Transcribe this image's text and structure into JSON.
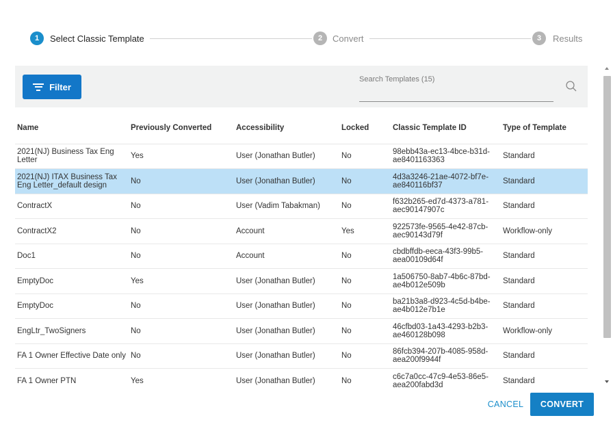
{
  "stepper": {
    "steps": [
      {
        "number": "1",
        "label": "Select Classic Template"
      },
      {
        "number": "2",
        "label": "Convert"
      },
      {
        "number": "3",
        "label": "Results"
      }
    ]
  },
  "toolbar": {
    "filter_label": "Filter",
    "search_placeholder": "Search Templates (15)"
  },
  "table": {
    "headers": [
      "Name",
      "Previously Converted",
      "Accessibility",
      "Locked",
      "Classic Template ID",
      "Type of Template"
    ],
    "rows": [
      {
        "name": "2021(NJ) Business Tax Eng Letter",
        "prev": "Yes",
        "access": "User (Jonathan Butler)",
        "locked": "No",
        "id": "98ebb43a-ec13-4bce-b31d-ae8401163363",
        "type": "Standard"
      },
      {
        "name": "2021(NJ) ITAX Business Tax Eng Letter_default design",
        "prev": "No",
        "access": "User (Jonathan Butler)",
        "locked": "No",
        "id": "4d3a3246-21ae-4072-bf7e-ae840116bf37",
        "type": "Standard"
      },
      {
        "name": "ContractX",
        "prev": "No",
        "access": "User (Vadim Tabakman)",
        "locked": "No",
        "id": "f632b265-ed7d-4373-a781-aec90147907c",
        "type": "Standard"
      },
      {
        "name": "ContractX2",
        "prev": "No",
        "access": "Account",
        "locked": "Yes",
        "id": "922573fe-9565-4e42-87cb-aec90143d79f",
        "type": "Workflow-only"
      },
      {
        "name": "Doc1",
        "prev": "No",
        "access": "Account",
        "locked": "No",
        "id": "cbdbffdb-eeca-43f3-99b5-aea00109d64f",
        "type": "Standard"
      },
      {
        "name": "EmptyDoc",
        "prev": "Yes",
        "access": "User (Jonathan Butler)",
        "locked": "No",
        "id": "1a506750-8ab7-4b6c-87bd-ae4b012e509b",
        "type": "Standard"
      },
      {
        "name": "EmptyDoc",
        "prev": "No",
        "access": "User (Jonathan Butler)",
        "locked": "No",
        "id": "ba21b3a8-d923-4c5d-b4be-ae4b012e7b1e",
        "type": "Standard"
      },
      {
        "name": "EngLtr_TwoSigners",
        "prev": "No",
        "access": "User (Jonathan Butler)",
        "locked": "No",
        "id": "46cfbd03-1a43-4293-b2b3-ae460128b098",
        "type": "Workflow-only"
      },
      {
        "name": "FA 1 Owner Effective Date only",
        "prev": "No",
        "access": "User (Jonathan Butler)",
        "locked": "No",
        "id": "86fcb394-207b-4085-958d-aea200f9944f",
        "type": "Standard"
      },
      {
        "name": "FA 1 Owner PTN",
        "prev": "Yes",
        "access": "User (Jonathan Butler)",
        "locked": "No",
        "id": "c6c7a0cc-47c9-4e53-86e5-aea200fabd3d",
        "type": "Standard"
      }
    ],
    "selected_row": 1
  },
  "footer": {
    "cancel_label": "CANCEL",
    "convert_label": "CONVERT"
  },
  "colors": {
    "accent": "#1a8ecb",
    "filter_button": "#1377c8",
    "selected_row": "#bde0f7"
  }
}
